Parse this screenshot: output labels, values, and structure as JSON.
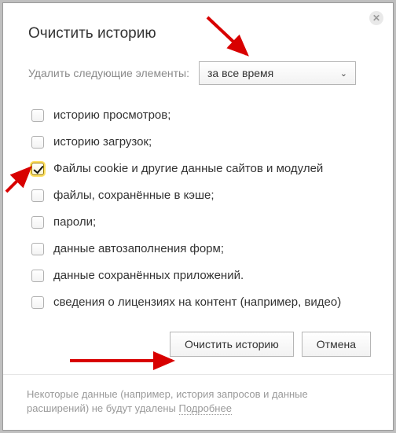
{
  "dialog": {
    "title": "Очистить историю",
    "delete_label": "Удалить следующие элементы:",
    "time_range_selected": "за все время",
    "checkboxes": [
      {
        "label": "историю просмотров;",
        "checked": false
      },
      {
        "label": "историю загрузок;",
        "checked": false
      },
      {
        "label": "Файлы cookie и другие данные сайтов и модулей",
        "checked": true
      },
      {
        "label": "файлы, сохранённые в кэше;",
        "checked": false
      },
      {
        "label": "пароли;",
        "checked": false
      },
      {
        "label": "данные автозаполнения форм;",
        "checked": false
      },
      {
        "label": "данные сохранённых приложений.",
        "checked": false
      },
      {
        "label": "сведения о лицензиях на контент (например, видео)",
        "checked": false
      }
    ],
    "buttons": {
      "clear": "Очистить историю",
      "cancel": "Отмена"
    },
    "footer_text": "Некоторые данные (например, история запросов и данные расширений) не будут удалены ",
    "footer_link": "Подробнее"
  }
}
